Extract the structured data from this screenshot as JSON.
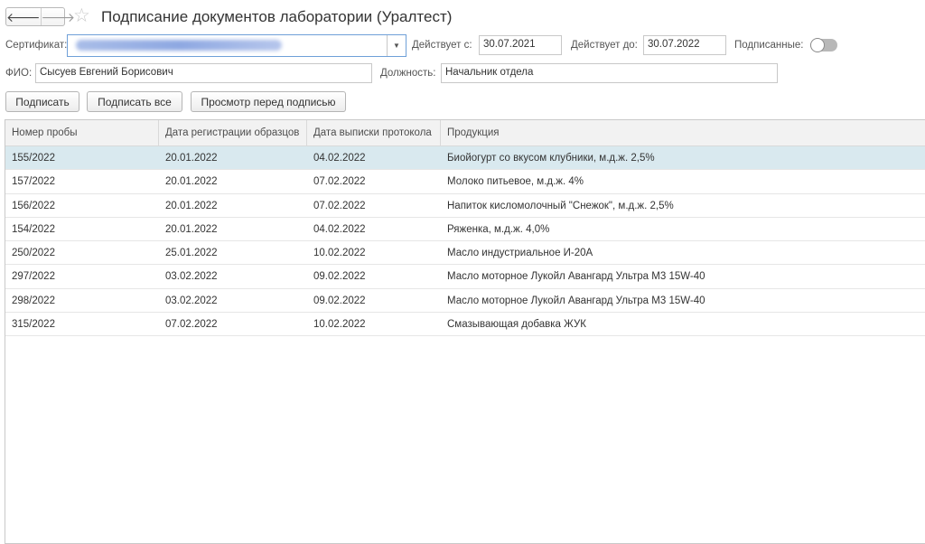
{
  "window": {
    "title": "Подписание документов лаборатории (Уралтест)",
    "back_glyph": "🡐",
    "forward_glyph": "🡒",
    "favorite_glyph": "☆"
  },
  "form": {
    "certificate_label": "Сертификат:",
    "certificate_value": "",
    "dropdown_glyph": "▼",
    "valid_from_label": "Действует с:",
    "valid_from_value": "30.07.2021",
    "valid_to_label": "Действует до:",
    "valid_to_value": "30.07.2022",
    "signed_label": "Подписанные:",
    "signed_toggle_on": false,
    "fio_label": "ФИО:",
    "fio_value": "Сысуев Евгений Борисович",
    "position_label": "Должность:",
    "position_value": "Начальник отдела"
  },
  "toolbar": {
    "sign_label": "Подписать",
    "sign_all_label": "Подписать все",
    "preview_label": "Просмотр перед подписью"
  },
  "table": {
    "columns": [
      "Номер пробы",
      "Дата регистрации образцов",
      "Дата выписки протокола",
      "Продукция"
    ],
    "rows": [
      [
        "155/2022",
        "20.01.2022",
        "04.02.2022",
        "Биойогурт со вкусом клубники, м.д.ж. 2,5%"
      ],
      [
        "157/2022",
        "20.01.2022",
        "07.02.2022",
        "Молоко питьевое, м.д.ж. 4%"
      ],
      [
        "156/2022",
        "20.01.2022",
        "07.02.2022",
        "Напиток кисломолочный \"Снежок\", м.д.ж. 2,5%"
      ],
      [
        "154/2022",
        "20.01.2022",
        "04.02.2022",
        "Ряженка, м.д.ж. 4,0%"
      ],
      [
        "250/2022",
        "25.01.2022",
        "10.02.2022",
        "Масло индустриальное И-20А"
      ],
      [
        "297/2022",
        "03.02.2022",
        "09.02.2022",
        "Масло моторное Лукойл Авангард Ультра М3 15W-40"
      ],
      [
        "298/2022",
        "03.02.2022",
        "09.02.2022",
        "Масло моторное Лукойл Авангард Ультра М3 15W-40"
      ],
      [
        "315/2022",
        "07.02.2022",
        "10.02.2022",
        "Смазывающая добавка ЖУК"
      ]
    ],
    "selected_row": 0
  },
  "colors": {
    "selected_row_bg": "#d9e9ef",
    "header_bg": "#f2f2f2",
    "focus_border": "#6fa0d8"
  }
}
